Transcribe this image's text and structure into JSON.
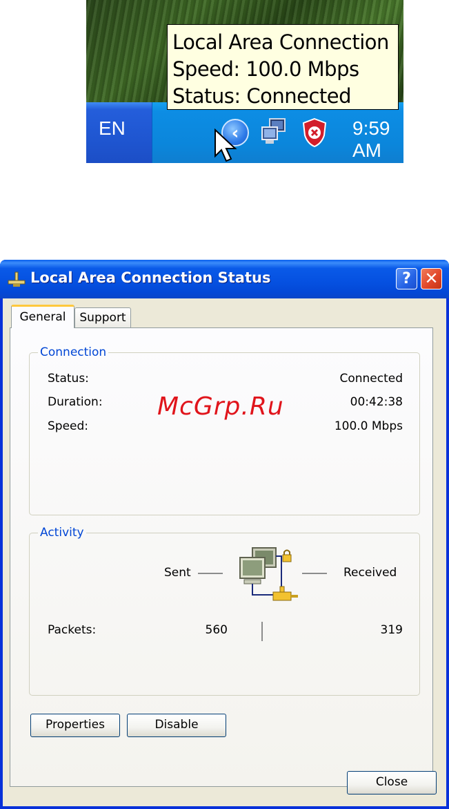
{
  "tray": {
    "tooltip": {
      "line1": "Local Area Connection",
      "line2": "Speed: 100.0 Mbps",
      "line3": "Status: Connected"
    },
    "language": "EN",
    "clock": "9:59 AM",
    "icons": [
      "chevron-left-icon",
      "network-icon",
      "security-shield-icon",
      "mouse-cursor-icon"
    ]
  },
  "dialog": {
    "title": "Local Area Connection Status",
    "help_glyph": "?",
    "close_glyph": "✕",
    "tabs": [
      {
        "label": "General",
        "selected": true
      },
      {
        "label": "Support",
        "selected": false
      }
    ],
    "connection": {
      "legend": "Connection",
      "status_label": "Status:",
      "status_value": "Connected",
      "duration_label": "Duration:",
      "duration_value": "00:42:38",
      "speed_label": "Speed:",
      "speed_value": "100.0 Mbps"
    },
    "activity": {
      "legend": "Activity",
      "sent_label": "Sent",
      "received_label": "Received",
      "packets_label": "Packets:",
      "packets_sent": "560",
      "packets_received": "319"
    },
    "buttons": {
      "properties": "Properties",
      "disable": "Disable",
      "close": "Close"
    }
  },
  "watermark": "McGrp.Ru",
  "colors": {
    "titlebar_blue": "#0550e0",
    "group_legend_blue": "#0046d5",
    "tooltip_bg": "#ffffe1",
    "watermark_red": "#e0141b",
    "dialog_face": "#ece9d8"
  }
}
